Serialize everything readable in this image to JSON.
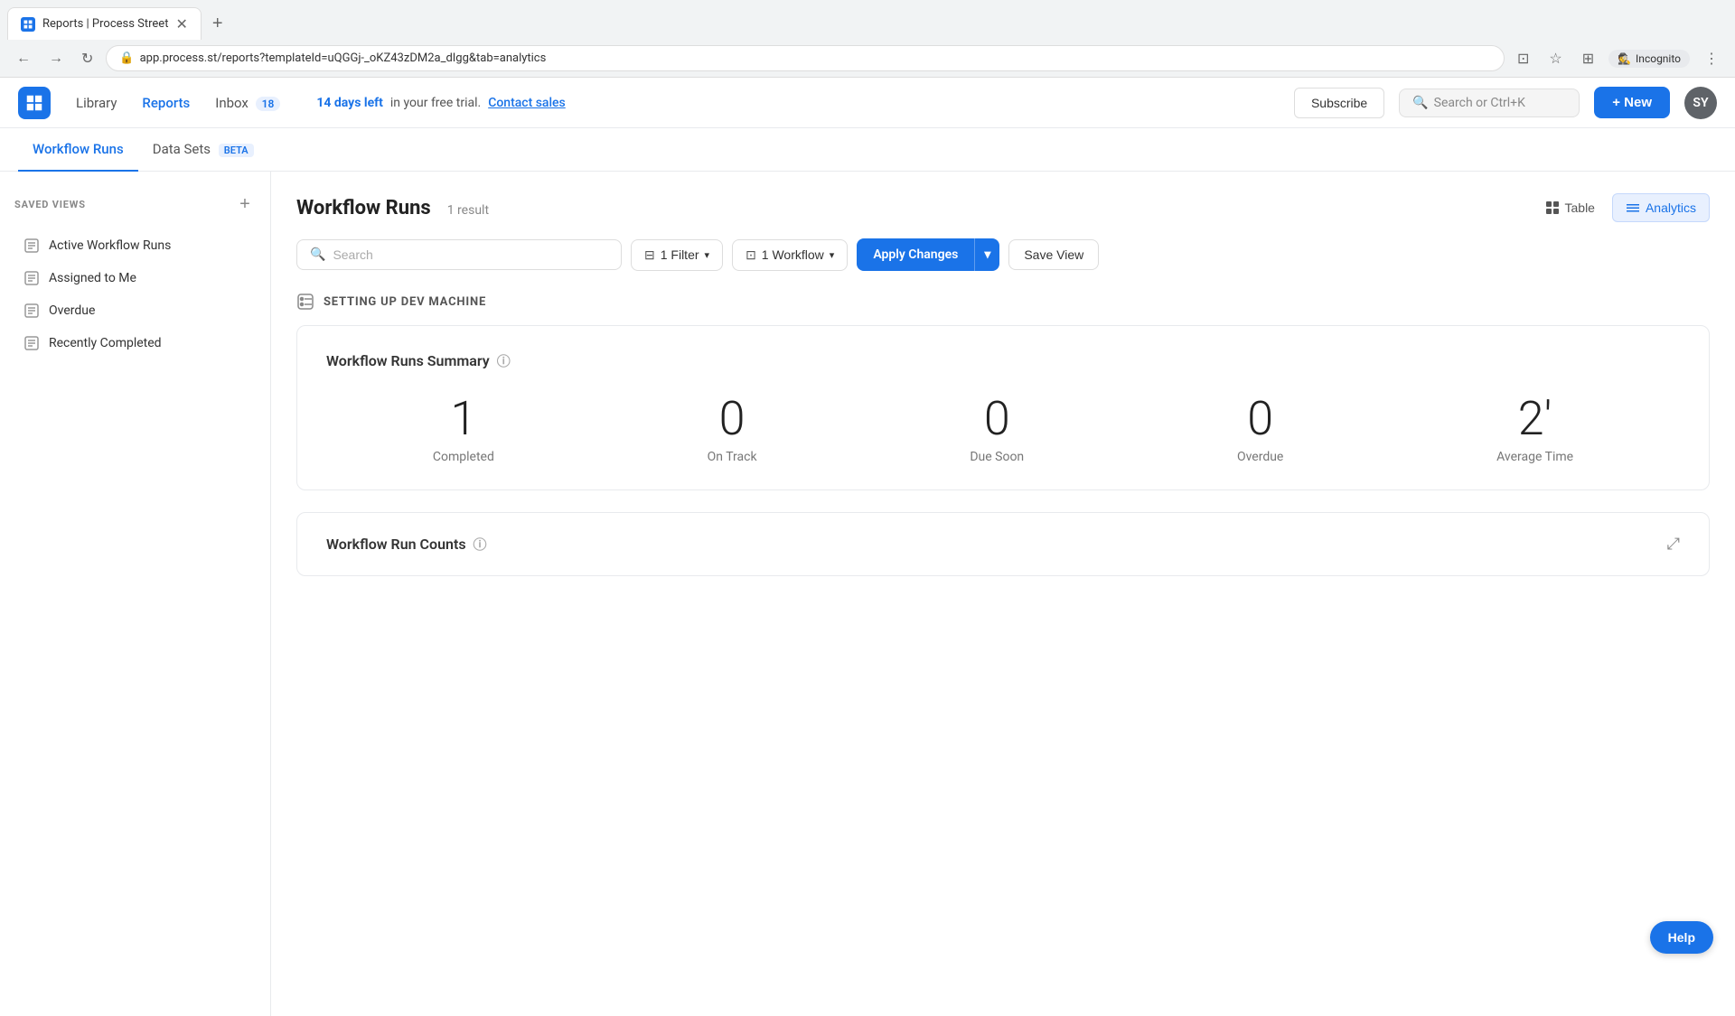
{
  "browser": {
    "tab_title": "Reports | Process Street",
    "tab_favicon": "PS",
    "url": "app.process.st/reports?templateId=uQGGj-_oKZ43zDM2a_dIgg&tab=analytics",
    "nav_back": "←",
    "nav_forward": "→",
    "nav_refresh": "↻",
    "incognito_label": "Incognito",
    "tab_add": "+",
    "browser_action_cast": "⊡",
    "browser_action_bookmark": "☆",
    "browser_action_profile": "👤",
    "browser_action_more": "⋮"
  },
  "header": {
    "nav_library": "Library",
    "nav_reports": "Reports",
    "nav_inbox": "Inbox",
    "inbox_count": "18",
    "trial_bold": "14 days left",
    "trial_text": " in your free trial.",
    "contact_sales": "Contact sales",
    "subscribe_label": "Subscribe",
    "search_placeholder": "Search or Ctrl+K",
    "new_label": "+ New",
    "avatar_initials": "SY"
  },
  "page_tabs": {
    "workflow_runs_label": "Workflow Runs",
    "data_sets_label": "Data Sets",
    "beta_label": "BETA"
  },
  "sidebar": {
    "saved_views_title": "SAVED VIEWS",
    "add_icon": "+",
    "items": [
      {
        "label": "Active Workflow Runs",
        "id": "active-workflow-runs"
      },
      {
        "label": "Assigned to Me",
        "id": "assigned-to-me"
      },
      {
        "label": "Overdue",
        "id": "overdue"
      },
      {
        "label": "Recently Completed",
        "id": "recently-completed"
      }
    ]
  },
  "content": {
    "title": "Workflow Runs",
    "result_count": "1 result",
    "view_table_label": "Table",
    "view_analytics_label": "Analytics",
    "search_placeholder": "Search",
    "filter_label": "1 Filter",
    "workflow_label": "1 Workflow",
    "apply_changes_label": "Apply Changes",
    "save_view_label": "Save View",
    "section_title": "SETTING UP DEV MACHINE",
    "summary_card": {
      "title": "Workflow Runs Summary",
      "stats": [
        {
          "number": "1",
          "label": "Completed"
        },
        {
          "number": "0",
          "label": "On Track"
        },
        {
          "number": "0",
          "label": "Due Soon"
        },
        {
          "number": "0",
          "label": "Overdue"
        },
        {
          "number": "2'",
          "label": "Average Time"
        }
      ]
    },
    "counts_card": {
      "title": "Workflow Run Counts"
    }
  },
  "help_label": "Help",
  "icons": {
    "table_icon": "⊞",
    "analytics_icon": "≡",
    "search_icon": "🔍",
    "filter_icon": "⊟",
    "workflow_icon": "⊡",
    "chevron_down": "∨",
    "section_icon": "⊟",
    "info_icon": "ⓘ",
    "expand_icon": "⤢",
    "doc_icon": "☰"
  }
}
